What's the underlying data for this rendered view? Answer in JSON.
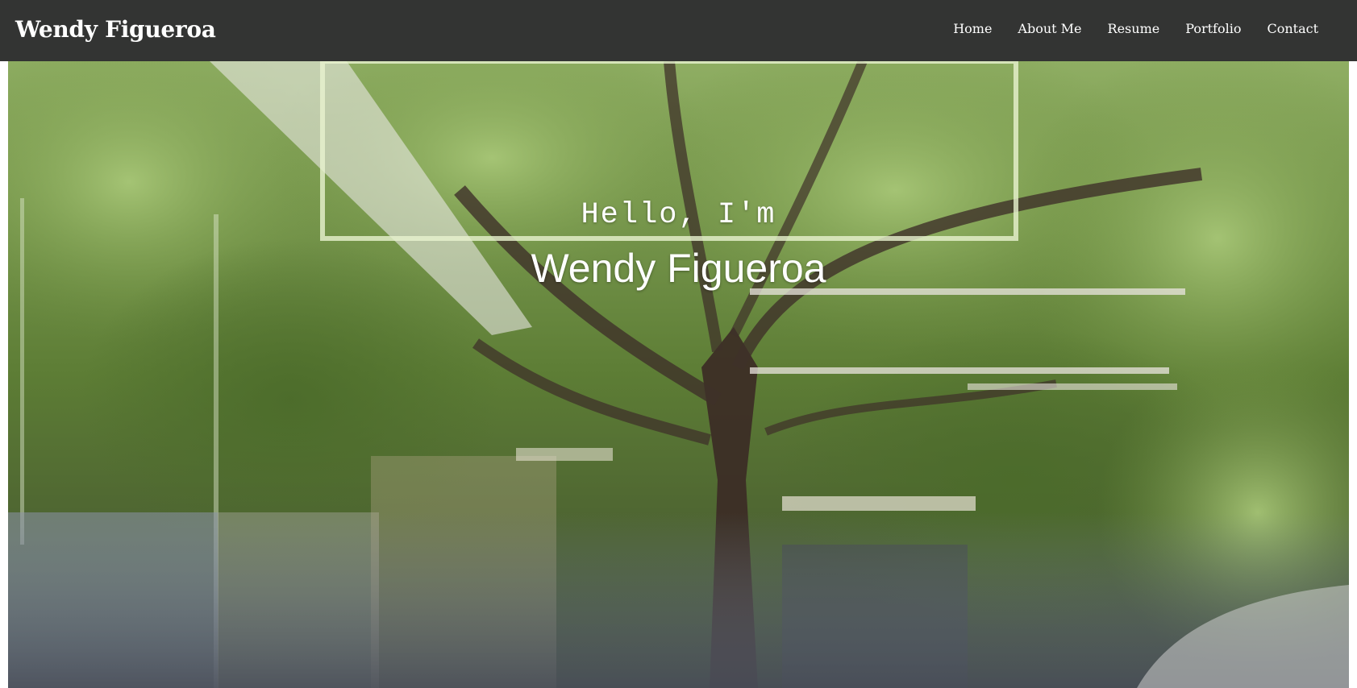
{
  "navbar": {
    "brand": "Wendy Figueroa",
    "links": [
      {
        "label": "Home"
      },
      {
        "label": "About Me"
      },
      {
        "label": "Resume"
      },
      {
        "label": "Portfolio"
      },
      {
        "label": "Contact"
      }
    ]
  },
  "hero": {
    "greeting": "Hello, I'm",
    "name": "Wendy Figueroa"
  },
  "colors": {
    "navbar_bg": "#333433",
    "nav_text": "#ffffff",
    "hero_text": "#ffffff"
  }
}
